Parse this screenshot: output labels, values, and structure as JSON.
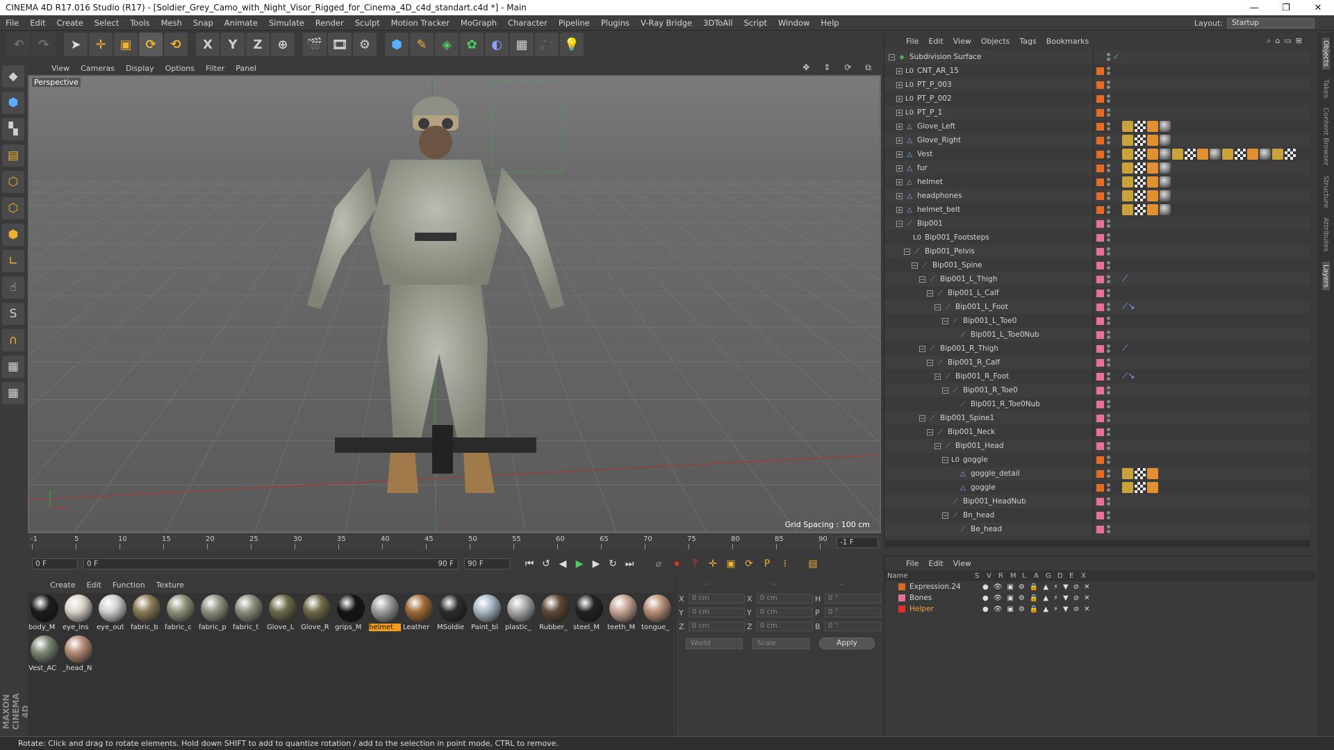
{
  "window": {
    "title": "CINEMA 4D R17.016 Studio (R17) - [Soldier_Grey_Camo_with_Night_Visor_Rigged_for_Cinema_4D_c4d_standart.c4d *] - Main",
    "min": "—",
    "restore": "❐",
    "close": "✕"
  },
  "menu": [
    "File",
    "Edit",
    "Create",
    "Select",
    "Tools",
    "Mesh",
    "Snap",
    "Animate",
    "Simulate",
    "Render",
    "Sculpt",
    "Motion Tracker",
    "MoGraph",
    "Character",
    "Pipeline",
    "Plugins",
    "V-Ray Bridge",
    "3DToAll",
    "Script",
    "Window",
    "Help"
  ],
  "layout": {
    "label": "Layout:",
    "value": "Startup"
  },
  "toolbar": {
    "x": "X",
    "y": "Y",
    "z": "Z"
  },
  "viewport": {
    "menu": [
      "View",
      "Cameras",
      "Display",
      "Options",
      "Filter",
      "Panel"
    ],
    "label": "Perspective",
    "grid": "Grid Spacing : 100 cm"
  },
  "timeline": {
    "ticks": [
      "-1",
      "5",
      "10",
      "15",
      "20",
      "25",
      "30",
      "35",
      "40",
      "45",
      "50",
      "55",
      "60",
      "65",
      "70",
      "75",
      "80",
      "85",
      "90"
    ],
    "end": "-1 F",
    "start_field": "0 F",
    "min_field": "0 F",
    "max_field": "90 F",
    "end_field": "90 F"
  },
  "materials": {
    "menu": [
      "Create",
      "Edit",
      "Function",
      "Texture"
    ],
    "items": [
      {
        "label": "body_M",
        "color": "#1c1c1c"
      },
      {
        "label": "eye_ins",
        "color": "#d9d2c8"
      },
      {
        "label": "eye_out",
        "color": "#cfcfcf"
      },
      {
        "label": "fabric_b",
        "color": "#8a7a55"
      },
      {
        "label": "fabric_c",
        "color": "#8f9179"
      },
      {
        "label": "fabric_p",
        "color": "#8e9381"
      },
      {
        "label": "fabric_t",
        "color": "#8b917f"
      },
      {
        "label": "Glove_L",
        "color": "#6d6b4a"
      },
      {
        "label": "Glove_R",
        "color": "#6e6a47"
      },
      {
        "label": "grips_M",
        "color": "#151515"
      },
      {
        "label": "helmet",
        "color": "#9c9c9c",
        "selected": true
      },
      {
        "label": "Leather",
        "color": "#a06b38"
      },
      {
        "label": "MSoldie",
        "color": "#2d2d2d"
      },
      {
        "label": "Paint_bl",
        "color": "#a9b8c6"
      },
      {
        "label": "plastic_",
        "color": "#aaaaaa"
      },
      {
        "label": "Rubber_",
        "color": "#5f4a38"
      },
      {
        "label": "steel_M",
        "color": "#222222"
      },
      {
        "label": "teeth_M",
        "color": "#c7a597"
      },
      {
        "label": "tongue_",
        "color": "#b88f77"
      },
      {
        "label": "Vest_AC",
        "color": "#7a8572"
      },
      {
        "label": "_head_N",
        "color": "#b48b74"
      }
    ]
  },
  "coords": {
    "rows": [
      {
        "a": "X",
        "v1": "0 cm",
        "b": "X",
        "v2": "0 cm",
        "c": "H",
        "v3": "0 °"
      },
      {
        "a": "Y",
        "v1": "0 cm",
        "b": "Y",
        "v2": "0 cm",
        "c": "P",
        "v3": "0 °"
      },
      {
        "a": "Z",
        "v1": "0 cm",
        "b": "Z",
        "v2": "0 cm",
        "c": "B",
        "v3": "0 °"
      }
    ],
    "header": "--",
    "world": "World",
    "scale": "Scale",
    "apply": "Apply"
  },
  "objects": {
    "menu": [
      "File",
      "Edit",
      "View",
      "Objects",
      "Tags",
      "Bookmarks"
    ],
    "rows": [
      {
        "name": "Subdivision Surface",
        "indent": 0,
        "icon": "subd",
        "exp": "−",
        "layer": "",
        "tags": ""
      },
      {
        "name": "CNT_AR_15",
        "indent": 1,
        "icon": "null",
        "exp": "+",
        "layer": "#e86b1f",
        "tags": ""
      },
      {
        "name": "PT_P_003",
        "indent": 1,
        "icon": "null",
        "exp": "+",
        "layer": "#e86b1f",
        "tags": ""
      },
      {
        "name": "PT_P_002",
        "indent": 1,
        "icon": "null",
        "exp": "+",
        "layer": "#e86b1f",
        "tags": ""
      },
      {
        "name": "PT_P_1",
        "indent": 1,
        "icon": "null",
        "exp": "+",
        "layer": "#e86b1f",
        "tags": ""
      },
      {
        "name": "Glove_Left",
        "indent": 1,
        "icon": "poly",
        "exp": "+",
        "layer": "#e86b1f",
        "tags": "4"
      },
      {
        "name": "Glove_Right",
        "indent": 1,
        "icon": "poly",
        "exp": "+",
        "layer": "#e86b1f",
        "tags": "4"
      },
      {
        "name": "Vest",
        "indent": 1,
        "icon": "poly",
        "exp": "+",
        "layer": "#e86b1f",
        "tags": "14"
      },
      {
        "name": "fur",
        "indent": 1,
        "icon": "poly",
        "exp": "+",
        "layer": "#e86b1f",
        "tags": "4"
      },
      {
        "name": "helmet",
        "indent": 1,
        "icon": "poly",
        "exp": "+",
        "layer": "#e86b1f",
        "tags": "4"
      },
      {
        "name": "headphones",
        "indent": 1,
        "icon": "poly",
        "exp": "+",
        "layer": "#e86b1f",
        "tags": "4"
      },
      {
        "name": "helmet_belt",
        "indent": 1,
        "icon": "poly",
        "exp": "+",
        "layer": "#e86b1f",
        "tags": "4"
      },
      {
        "name": "Bip001",
        "indent": 1,
        "icon": "bone",
        "exp": "−",
        "layer": "#e9709c",
        "tags": ""
      },
      {
        "name": "Bip001_Footsteps",
        "indent": 2,
        "icon": "null",
        "exp": "",
        "layer": "#e9709c",
        "tags": ""
      },
      {
        "name": "Bip001_Pelvis",
        "indent": 2,
        "icon": "bone",
        "exp": "−",
        "layer": "#e9709c",
        "tags": ""
      },
      {
        "name": "Bip001_Spine",
        "indent": 3,
        "icon": "bone",
        "exp": "−",
        "layer": "#e9709c",
        "tags": ""
      },
      {
        "name": "Bip001_L_Thigh",
        "indent": 4,
        "icon": "bone",
        "exp": "−",
        "layer": "#e9709c",
        "tags": "ik"
      },
      {
        "name": "Bip001_L_Calf",
        "indent": 5,
        "icon": "bone",
        "exp": "−",
        "layer": "#e9709c",
        "tags": ""
      },
      {
        "name": "Bip001_L_Foot",
        "indent": 6,
        "icon": "bone",
        "exp": "−",
        "layer": "#e9709c",
        "tags": "ik2"
      },
      {
        "name": "Bip001_L_Toe0",
        "indent": 7,
        "icon": "bone",
        "exp": "−",
        "layer": "#e9709c",
        "tags": ""
      },
      {
        "name": "Bip001_L_Toe0Nub",
        "indent": 8,
        "icon": "bone",
        "exp": "",
        "layer": "#e9709c",
        "tags": ""
      },
      {
        "name": "Bip001_R_Thigh",
        "indent": 4,
        "icon": "bone",
        "exp": "−",
        "layer": "#e9709c",
        "tags": "ik"
      },
      {
        "name": "Bip001_R_Calf",
        "indent": 5,
        "icon": "bone",
        "exp": "−",
        "layer": "#e9709c",
        "tags": ""
      },
      {
        "name": "Bip001_R_Foot",
        "indent": 6,
        "icon": "bone",
        "exp": "−",
        "layer": "#e9709c",
        "tags": "ik2"
      },
      {
        "name": "Bip001_R_Toe0",
        "indent": 7,
        "icon": "bone",
        "exp": "−",
        "layer": "#e9709c",
        "tags": ""
      },
      {
        "name": "Bip001_R_Toe0Nub",
        "indent": 8,
        "icon": "bone",
        "exp": "",
        "layer": "#e9709c",
        "tags": ""
      },
      {
        "name": "Bip001_Spine1",
        "indent": 4,
        "icon": "bone",
        "exp": "−",
        "layer": "#e9709c",
        "tags": ""
      },
      {
        "name": "Bip001_Neck",
        "indent": 5,
        "icon": "bone",
        "exp": "−",
        "layer": "#e9709c",
        "tags": ""
      },
      {
        "name": "Bip001_Head",
        "indent": 6,
        "icon": "bone",
        "exp": "−",
        "layer": "#e9709c",
        "tags": ""
      },
      {
        "name": "goggle",
        "indent": 7,
        "icon": "null",
        "exp": "−",
        "layer": "#e86b1f",
        "tags": ""
      },
      {
        "name": "goggle_detail",
        "indent": 8,
        "icon": "poly",
        "exp": "",
        "layer": "#e86b1f",
        "tags": "3"
      },
      {
        "name": "goggle",
        "indent": 8,
        "icon": "poly",
        "exp": "",
        "layer": "#e86b1f",
        "tags": "3"
      },
      {
        "name": "Bip001_HeadNub",
        "indent": 7,
        "icon": "bone",
        "exp": "",
        "layer": "#e9709c",
        "tags": ""
      },
      {
        "name": "Bn_head",
        "indent": 7,
        "icon": "bone",
        "exp": "−",
        "layer": "#e9709c",
        "tags": ""
      },
      {
        "name": "Be_head",
        "indent": 8,
        "icon": "bone",
        "exp": "",
        "layer": "#e9709c",
        "tags": ""
      }
    ]
  },
  "layers": {
    "menu": [
      "File",
      "Edit",
      "View"
    ],
    "header": [
      "Name",
      "S",
      "V",
      "R",
      "M",
      "L",
      "A",
      "G",
      "D",
      "E",
      "X"
    ],
    "rows": [
      {
        "name": "Expression.24",
        "color": "#d86a2a",
        "text": "#d4d4d4"
      },
      {
        "name": "Bones",
        "color": "#e9709c",
        "text": "#d4d4d4"
      },
      {
        "name": "Helper",
        "color": "#e03030",
        "text": "#f0a040"
      }
    ]
  },
  "righttabs": [
    "Objects",
    "Takes",
    "Content Browser",
    "Structure",
    "Attributes",
    "Layers"
  ],
  "status": "Rotate: Click and drag to rotate elements. Hold down SHIFT to add to quantize rotation / add to the selection in point mode, CTRL to remove.",
  "brand": "MAXON CINEMA 4D"
}
